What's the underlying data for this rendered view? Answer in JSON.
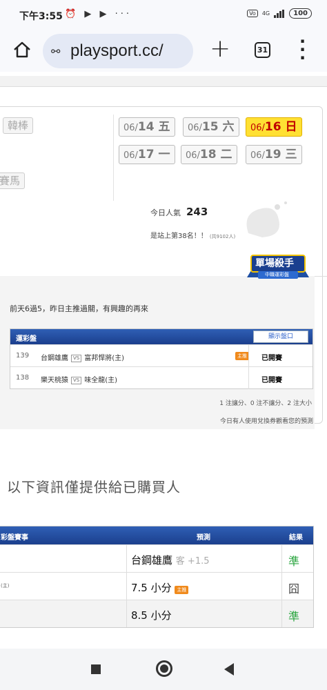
{
  "status_bar": {
    "time": "下午3:55",
    "left_icons": "⏰ ▶ ▶ ···",
    "network": "4G",
    "battery": "100"
  },
  "browser": {
    "url": "playsport.cc/",
    "tab_count": "31"
  },
  "page": {
    "sports": [
      "韓棒",
      "賽馬"
    ],
    "dates": [
      {
        "prefix": "06/",
        "day": "14",
        "weekday": "五",
        "active": false
      },
      {
        "prefix": "06/",
        "day": "15",
        "weekday": "六",
        "active": false
      },
      {
        "prefix": "06/",
        "day": "16",
        "weekday": "日",
        "active": true
      },
      {
        "prefix": "06/",
        "day": "17",
        "weekday": "一",
        "active": false
      },
      {
        "prefix": "06/",
        "day": "18",
        "weekday": "二",
        "active": false
      },
      {
        "prefix": "06/",
        "day": "19",
        "weekday": "三",
        "active": false
      }
    ],
    "popularity_label": "今日人氣",
    "popularity_value": "243",
    "rank_text": "是站上第38名！！",
    "rank_small": "(共9102人)",
    "badge_title": "單場殺手",
    "badge_sub": "中職運彩盤",
    "message": "前天6過5，昨日主推過關，有興趣的再來",
    "games_table": {
      "header": "運彩盤",
      "odds_button": "顯示盤口",
      "rows": [
        {
          "num": "139",
          "away": "台鋼雄鷹",
          "vs": "VS",
          "home": "富邦悍將(主)",
          "tag": "主推",
          "status": "已開賽"
        },
        {
          "num": "138",
          "away": "樂天桃猿",
          "vs": "VS",
          "home": "味全龍(主)",
          "tag": "",
          "status": "已開賽"
        }
      ]
    },
    "note1": "1 注讓分、0 注不讓分、2 注大小",
    "note2": "今日有人使用兌換券觀看您的預測",
    "buyer_notice": "以下資訊僅提供給已購買人",
    "pred_table": {
      "headers": {
        "game": "彩盤賽事",
        "prediction": "預測",
        "result": "結果"
      },
      "rows": [
        {
          "side": "",
          "pick": "台鋼雄鷹",
          "extra": "客 +1.5",
          "tag": "",
          "result": "準",
          "good": true
        },
        {
          "side": "(主)",
          "pick": "7.5 小分",
          "extra": "",
          "tag": "主推",
          "result": "囧",
          "good": false
        },
        {
          "side": "",
          "pick": "8.5 小分",
          "extra": "",
          "tag": "",
          "result": "準",
          "good": true
        }
      ]
    }
  }
}
